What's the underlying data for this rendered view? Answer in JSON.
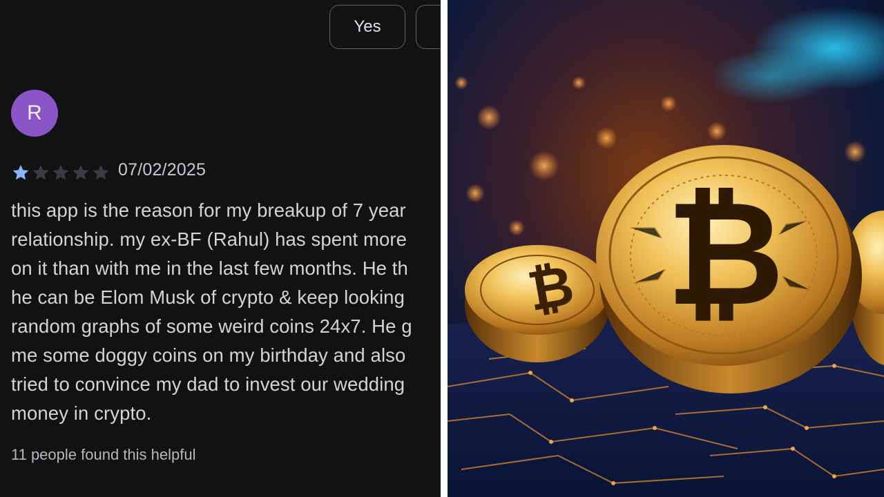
{
  "review": {
    "buttons": {
      "yes_label": "Yes"
    },
    "reviewer_initial": "R",
    "rating": 1,
    "rating_max": 5,
    "date": "07/02/2025",
    "text_lines": [
      "this app is the reason for my breakup of 7 year",
      "relationship. my ex-BF (Rahul) has spent more",
      "on it than with me in the last few months. He th",
      "he can be Elom Musk of crypto & keep looking",
      "random graphs of some weird coins 24x7. He g",
      "me some doggy coins on my birthday and also",
      "tried to convince my dad to invest our wedding",
      "money in crypto."
    ],
    "helpful_text": "11 people found this helpful"
  },
  "photo": {
    "subject": "bitcoin-coins",
    "colors": {
      "gold": "#d9a441",
      "dark_gold": "#6b3f0c",
      "background": "#0b1a3a",
      "accent": "#1fb6e8"
    }
  }
}
